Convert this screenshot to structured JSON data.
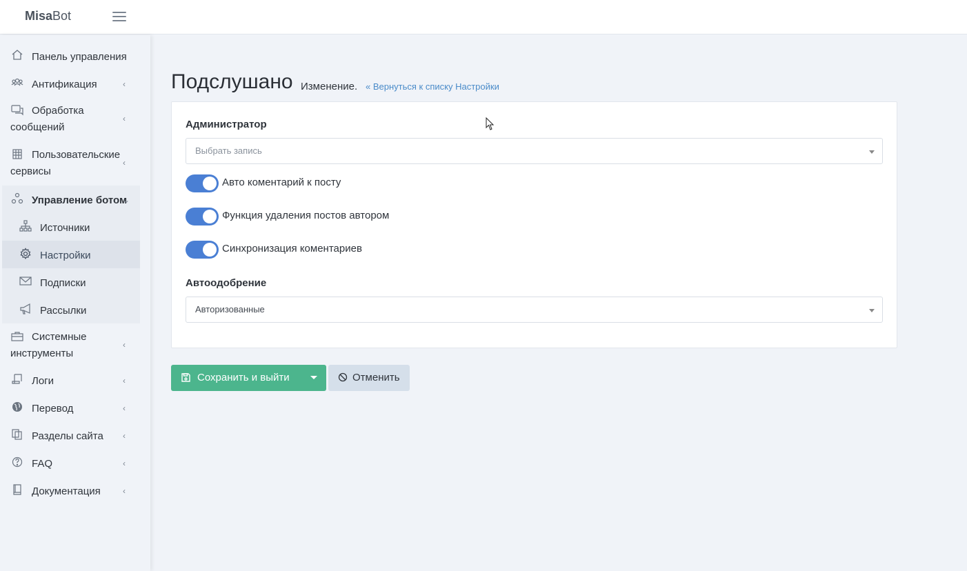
{
  "brand": {
    "bold": "Misa",
    "rest": "Bot"
  },
  "sidebar": {
    "items": [
      {
        "label": "Панель управления",
        "icon": "home-icon"
      },
      {
        "label": "Антификация",
        "icon": "users-icon"
      },
      {
        "label": "Обработка сообщений",
        "icon": "chat-icon"
      },
      {
        "label": "Пользовательские сервисы",
        "icon": "grid-icon"
      },
      {
        "label": "Управление ботом",
        "icon": "nodes-icon"
      },
      {
        "label": "Системные инструменты",
        "icon": "briefcase-icon"
      },
      {
        "label": "Логи",
        "icon": "scroll-icon"
      },
      {
        "label": "Перевод",
        "icon": "globe-icon"
      },
      {
        "label": "Разделы сайта",
        "icon": "copy-icon"
      },
      {
        "label": "FAQ",
        "icon": "question-icon"
      },
      {
        "label": "Документация",
        "icon": "book-icon"
      }
    ],
    "subitems": [
      {
        "label": "Источники",
        "icon": "sitemap-icon"
      },
      {
        "label": "Настройки",
        "icon": "cog-icon"
      },
      {
        "label": "Подписки",
        "icon": "envelope-icon"
      },
      {
        "label": "Рассылки",
        "icon": "megaphone-icon"
      }
    ]
  },
  "page": {
    "title": "Подслушано",
    "subtitle": "Изменение.",
    "back_link": "Вернуться к списку Настройки"
  },
  "form": {
    "admin_label": "Администратор",
    "admin_placeholder": "Выбрать запись",
    "toggles": [
      {
        "label": "Авто коментарий к посту",
        "on": true
      },
      {
        "label": "Функция удаления постов автором",
        "on": true
      },
      {
        "label": "Синхронизация коментариев",
        "on": true
      }
    ],
    "autoapprove_label": "Автоодобрение",
    "autoapprove_value": "Авторизованные"
  },
  "buttons": {
    "save": "Сохранить и выйти",
    "cancel": "Отменить"
  },
  "colors": {
    "accent": "#4a7fd4",
    "save": "#4cb58d",
    "cancel": "#d5dfea",
    "link": "#4a8bc9"
  }
}
